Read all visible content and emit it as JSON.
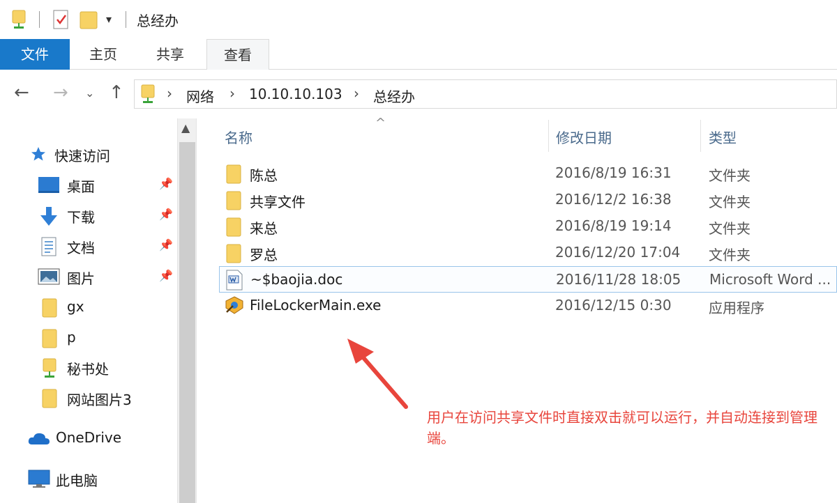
{
  "window": {
    "title": "总经办"
  },
  "ribbon": {
    "tabs": [
      {
        "label": "文件"
      },
      {
        "label": "主页"
      },
      {
        "label": "共享"
      },
      {
        "label": "查看"
      }
    ]
  },
  "address": {
    "crumbs": [
      "网络",
      "10.10.10.103",
      "总经办"
    ]
  },
  "sidebar": {
    "quick_access": "快速访问",
    "items": [
      {
        "label": "桌面",
        "icon": "desktop-icon",
        "pinned": true
      },
      {
        "label": "下载",
        "icon": "download-icon",
        "pinned": true
      },
      {
        "label": "文档",
        "icon": "documents-icon",
        "pinned": true
      },
      {
        "label": "图片",
        "icon": "pictures-icon",
        "pinned": true
      },
      {
        "label": "gx",
        "icon": "folder-icon",
        "pinned": false
      },
      {
        "label": "p",
        "icon": "folder-icon",
        "pinned": false
      },
      {
        "label": "秘书处",
        "icon": "network-folder-icon",
        "pinned": false
      },
      {
        "label": "网站图片3",
        "icon": "folder-icon",
        "pinned": false
      }
    ],
    "onedrive": "OneDrive",
    "this_pc": "此电脑"
  },
  "columns": {
    "name": "名称",
    "modified": "修改日期",
    "type": "类型"
  },
  "files": [
    {
      "name": "陈总",
      "modified": "2016/8/19 16:31",
      "type": "文件夹",
      "icon": "folder-icon"
    },
    {
      "name": "共享文件",
      "modified": "2016/12/2 16:38",
      "type": "文件夹",
      "icon": "folder-icon"
    },
    {
      "name": "来总",
      "modified": "2016/8/19 19:14",
      "type": "文件夹",
      "icon": "folder-icon"
    },
    {
      "name": "罗总",
      "modified": "2016/12/20 17:04",
      "type": "文件夹",
      "icon": "folder-icon"
    },
    {
      "name": "~$baojia.doc",
      "modified": "2016/11/28 18:05",
      "type": "Microsoft Word ...",
      "icon": "word-doc-icon",
      "selected": true
    },
    {
      "name": "FileLockerMain.exe",
      "modified": "2016/12/15 0:30",
      "type": "应用程序",
      "icon": "exe-app-icon"
    }
  ],
  "annotation": {
    "text": "用户在访问共享文件时直接双击就可以运行，并自动连接到管理端。",
    "color": "#e8453c"
  },
  "colors": {
    "accent": "#1979ca",
    "folder": "#f7d264",
    "annotation": "#e8453c"
  }
}
